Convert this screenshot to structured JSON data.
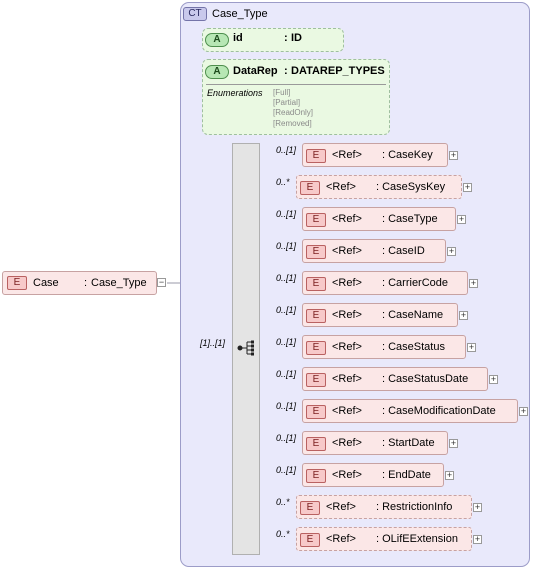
{
  "root_element": {
    "badge": "E",
    "name": "Case",
    "type_sep": ":",
    "type": "Case_Type"
  },
  "complex_type": {
    "badge": "CT",
    "name": "Case_Type",
    "attributes": [
      {
        "badge": "A",
        "name": "id",
        "sep": ":",
        "type": "ID"
      },
      {
        "badge": "A",
        "name": "DataRep",
        "sep": ":",
        "type": "DATAREP_TYPES",
        "enumerations_label": "Enumerations",
        "enumerations": [
          "[Full]",
          "[Partial]",
          "[ReadOnly]",
          "[Removed]"
        ]
      }
    ],
    "sequence": {
      "cardinality": "[1]..[1]",
      "icon": "sequence-icon",
      "elements": [
        {
          "card": "0..[1]",
          "badge": "E",
          "ref": "<Ref>",
          "name": ": CaseKey",
          "optional": false
        },
        {
          "card": "0..*",
          "badge": "E",
          "ref": "<Ref>",
          "name": ": CaseSysKey",
          "optional": true
        },
        {
          "card": "0..[1]",
          "badge": "E",
          "ref": "<Ref>",
          "name": ": CaseType",
          "optional": false
        },
        {
          "card": "0..[1]",
          "badge": "E",
          "ref": "<Ref>",
          "name": ": CaseID",
          "optional": false
        },
        {
          "card": "0..[1]",
          "badge": "E",
          "ref": "<Ref>",
          "name": ": CarrierCode",
          "optional": false
        },
        {
          "card": "0..[1]",
          "badge": "E",
          "ref": "<Ref>",
          "name": ": CaseName",
          "optional": false
        },
        {
          "card": "0..[1]",
          "badge": "E",
          "ref": "<Ref>",
          "name": ": CaseStatus",
          "optional": false
        },
        {
          "card": "0..[1]",
          "badge": "E",
          "ref": "<Ref>",
          "name": ": CaseStatusDate",
          "optional": false
        },
        {
          "card": "0..[1]",
          "badge": "E",
          "ref": "<Ref>",
          "name": ": CaseModificationDate",
          "optional": false
        },
        {
          "card": "0..[1]",
          "badge": "E",
          "ref": "<Ref>",
          "name": ": StartDate",
          "optional": false
        },
        {
          "card": "0..[1]",
          "badge": "E",
          "ref": "<Ref>",
          "name": ": EndDate",
          "optional": false
        },
        {
          "card": "0..*",
          "badge": "E",
          "ref": "<Ref>",
          "name": ": RestrictionInfo",
          "optional": true
        },
        {
          "card": "0..*",
          "badge": "E",
          "ref": "<Ref>",
          "name": ": OLifEExtension",
          "optional": true
        }
      ]
    }
  },
  "expand_symbol": "+",
  "collapse_symbol": "−",
  "colors": {
    "complex_type_bg": "#e9e9fb",
    "attribute_bg": "#eaf9e2",
    "element_bg": "#fbe7e7",
    "element_badge": "#f7c9c9",
    "attribute_badge": "#b7e7b4"
  }
}
